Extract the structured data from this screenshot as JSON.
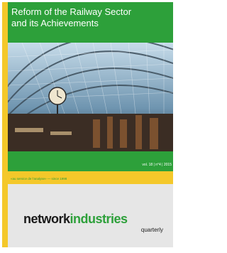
{
  "cover": {
    "title_line1": "Reform of the Railway Sector",
    "title_line2": "and its Achievements",
    "volume": "vol. 18 | n°4 | 2015",
    "tagline": "«au service de l’analyse» — since 1998",
    "logo_part1": "network",
    "logo_part2": "industries",
    "logo_sub": "quarterly",
    "colors": {
      "green": "#2da03a",
      "yellow": "#f4c82a",
      "footer": "#e6e6e6"
    }
  }
}
